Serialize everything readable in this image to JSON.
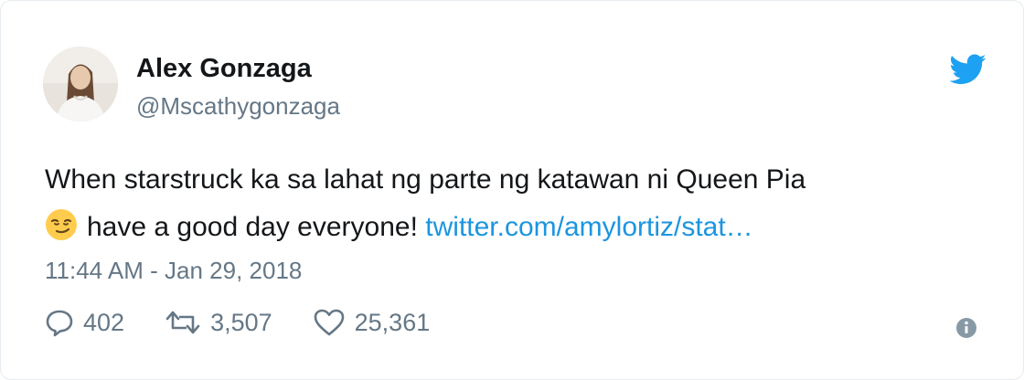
{
  "user": {
    "display_name": "Alex Gonzaga",
    "handle": "@Mscathygonzaga",
    "avatar_icon": "profile-photo"
  },
  "tweet": {
    "line1": "When starstruck ka sa lahat ng parte ng katawan ni Queen Pia",
    "emoji": "smirking-face-emoji",
    "line2_text": "have a good day everyone! ",
    "link_text": "twitter.com/amylortiz/stat…",
    "timestamp": "11:44 AM - Jan 29, 2018"
  },
  "actions": {
    "reply_count": "402",
    "retweet_count": "3,507",
    "like_count": "25,361"
  },
  "colors": {
    "twitter_blue": "#1da1f2",
    "link": "#1b95e0",
    "secondary_text": "#657786",
    "primary_text": "#14171a"
  }
}
